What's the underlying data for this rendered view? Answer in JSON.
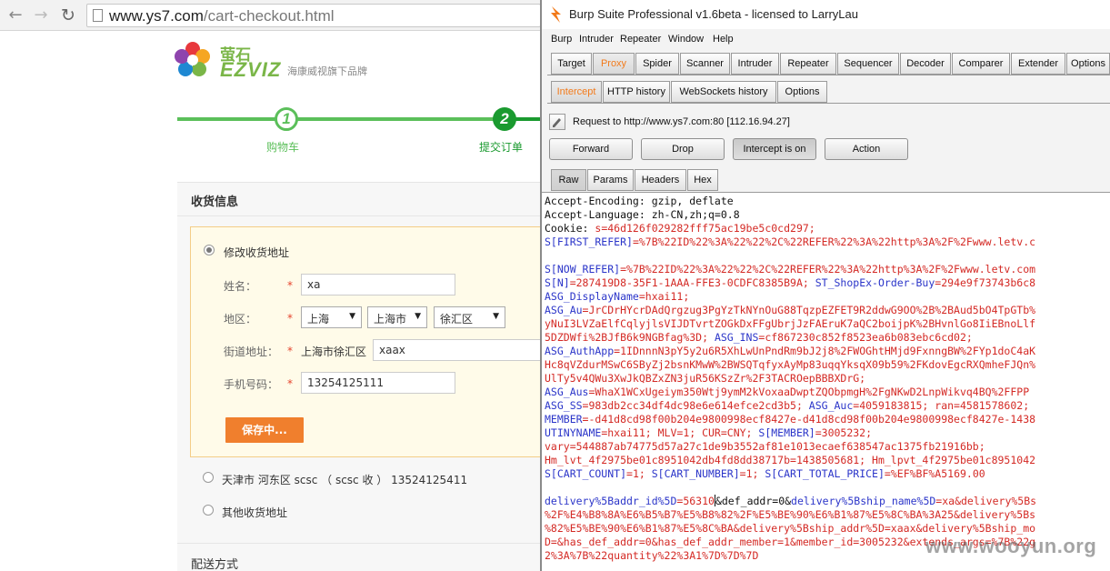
{
  "browser": {
    "url_domain": "www.ys7.com",
    "url_path": "/cart-checkout.html"
  },
  "site": {
    "logo_cn": "萤石",
    "logo_en": "EZVIZ",
    "slogan": "海康威视旗下品牌",
    "steps": [
      {
        "num": "1",
        "label": "购物车"
      },
      {
        "num": "2",
        "label": "提交订单"
      }
    ],
    "section_title": "收货信息",
    "edit_address_label": "修改收货地址",
    "form": {
      "name_label": "姓名：",
      "name_value": "xa",
      "region_label": "地区：",
      "province": "上海",
      "city": "上海市",
      "district": "徐汇区",
      "street_label": "街道地址：",
      "street_prefix": "上海市徐汇区",
      "street_value": "xaax",
      "phone_label": "手机号码：",
      "phone_value": "13254125111",
      "required_mark": "*",
      "save_button": "保存中..."
    },
    "address_option": "天津市 河东区 scsc （ scsc 收 ） 13524125411",
    "other_address_label": "其他收货地址",
    "delivery_title": "配送方式"
  },
  "burp": {
    "title": "Burp Suite Professional v1.6beta - licensed to LarryLau",
    "menu": [
      "Burp",
      "Intruder",
      "Repeater",
      "Window",
      "Help"
    ],
    "main_tabs": [
      "Target",
      "Proxy",
      "Spider",
      "Scanner",
      "Intruder",
      "Repeater",
      "Sequencer",
      "Decoder",
      "Comparer",
      "Extender",
      "Options"
    ],
    "main_active": "Proxy",
    "proxy_tabs": [
      "Intercept",
      "HTTP history",
      "WebSockets history",
      "Options"
    ],
    "proxy_active": "Intercept",
    "request_text": "Request to http://www.ys7.com:80  [112.16.94.27]",
    "buttons": {
      "forward": "Forward",
      "drop": "Drop",
      "intercept": "Intercept is on",
      "action": "Action"
    },
    "view_tabs": [
      "Raw",
      "Params",
      "Headers",
      "Hex"
    ],
    "view_active": "Raw",
    "colors": {
      "active_tab": "#f27a1a",
      "param_name": "#2b35c9",
      "param_value": "#d42a25"
    },
    "lines": [
      {
        "k": "Accept-Encoding: gzip, deflate"
      },
      {
        "k": "Accept-Language: zh-CN,zh;q=0.8"
      },
      {
        "k": "Cookie: ",
        "v": "s=46d126f029282fff75ac19be5c0cd297;"
      },
      {
        "n": "S[FIRST_REFER]",
        "v": "=%7B%22ID%22%3A%22%22%2C%22REFER%22%3A%22http%3A%2F%2Fwww.letv.c"
      },
      {
        "k": ""
      },
      {
        "n": "S[NOW_REFER]",
        "v": "=%7B%22ID%22%3A%22%22%2C%22REFER%22%3A%22http%3A%2F%2Fwww.letv.com"
      },
      {
        "n": "S[N]",
        "v": "=287419D8-35F1-1AAA-FFE3-0CDFC8385B9A; ",
        "n2": "ST_ShopEx-Order-Buy",
        "v2": "=294e9f73743b6c8"
      },
      {
        "n": "ASG_DisplayName",
        "v": "=hxai11;"
      },
      {
        "n": "ASG_Au",
        "v": "=JrCDrHYcrDAdQrgzug3PgYzTkNYnOuG88TqzpEZFET9R2ddwG9OO%2B%2BAud5bO4TpGTb%"
      },
      {
        "v": "yNuI3LVZaElfCqlyjlsVIJDTvrtZOGkDxFFgUbrjJzFAEruK7aQC2boijpK%2BHvnlGo8IiEBnoLlf"
      },
      {
        "v": "5DZDWfi%2BJfB6k9NGBfag%3D; ",
        "n2": "ASG_INS",
        "v2": "=cf867230c852f8523ea6b083ebc6cd02;"
      },
      {
        "n": "ASG_AuthApp",
        "v": "=1IDnnnN3pY5y2u6R5XhLwUnPndRm9bJ2j8%2FWOGhtHMjd9FxnngBW%2FYp1doC4aK"
      },
      {
        "v": "Hc8qVZdurMSwC6SByZj2bsnKMwW%2BWSQTqfyxAyMp83uqqYksqX09b59%2FKdovEgcRXQmheFJQn%"
      },
      {
        "v": "UlTy5v4QWu3XwJkQBZxZN3juR56KSzZr%2F3TACROepBBBXDrG;"
      },
      {
        "n": "ASG_Aus",
        "v": "=WhaX1WCxUgeiym350Wtj9ymM2kVoxaaDwptZQObpmgH%2FgNKwD2LnpWikvq4BQ%2FFPP"
      },
      {
        "n": "ASG_SS",
        "v": "=983db2cc34df4dc98e6e614efce2cd3b5; ",
        "n2": "ASG_Auc",
        "v2": "=4059183815; ran=4581578602;"
      },
      {
        "n": "MEMBER",
        "v": "=-d41d8cd98f00b204e9800998ecf8427e-d41d8cd98f00b204e9800998ecf8427e-1438"
      },
      {
        "n": "UTINYNAME",
        "v": "=hxai11; MLV=1; CUR=CNY; ",
        "n2": "S[MEMBER]",
        "v2": "=3005232;"
      },
      {
        "v": "vary=544887ab74775d57a27c1de9b3552af81e1013ecaef638547ac1375fb21916bb;"
      },
      {
        "v": "Hm_lvt_4f2975be01c8951042db4fd8dd38717b=1438505681; Hm_lpvt_4f2975be01c8951042"
      },
      {
        "n": "S[CART_COUNT]",
        "v": "=1; ",
        "n2": "S[CART_NUMBER]",
        "v2": "=1; ",
        "n3": "S[CART_TOTAL_PRICE]",
        "v3": "=%EF%BF%A5169.00"
      },
      {
        "k": ""
      },
      {
        "n": "delivery%5Baddr_id%5D",
        "v": "=56310",
        "cursor": true,
        "k2": "&def_addr=0&",
        "n2": "delivery%5Bship_name%5D",
        "v2": "=xa&delivery%5Bs"
      },
      {
        "v": "%2F%E4%B8%8A%E6%B5%B7%E5%B8%82%2F%E5%BE%90%E6%B1%87%E5%8C%BA%3A25&delivery%5Bs"
      },
      {
        "v": "%82%E5%BE%90%E6%B1%87%E5%8C%BA&delivery%5Bship_addr%5D=xaax&delivery%5Bship_mo"
      },
      {
        "v": "D=&has_def_addr=0&has_def_addr_member=1&member_id=3005232&extends_args=%7B%22g"
      },
      {
        "v": "2%3A%7B%22quantity%22%3A1%7D%7D%7D"
      }
    ],
    "watermark": "www.wooyun.org"
  }
}
